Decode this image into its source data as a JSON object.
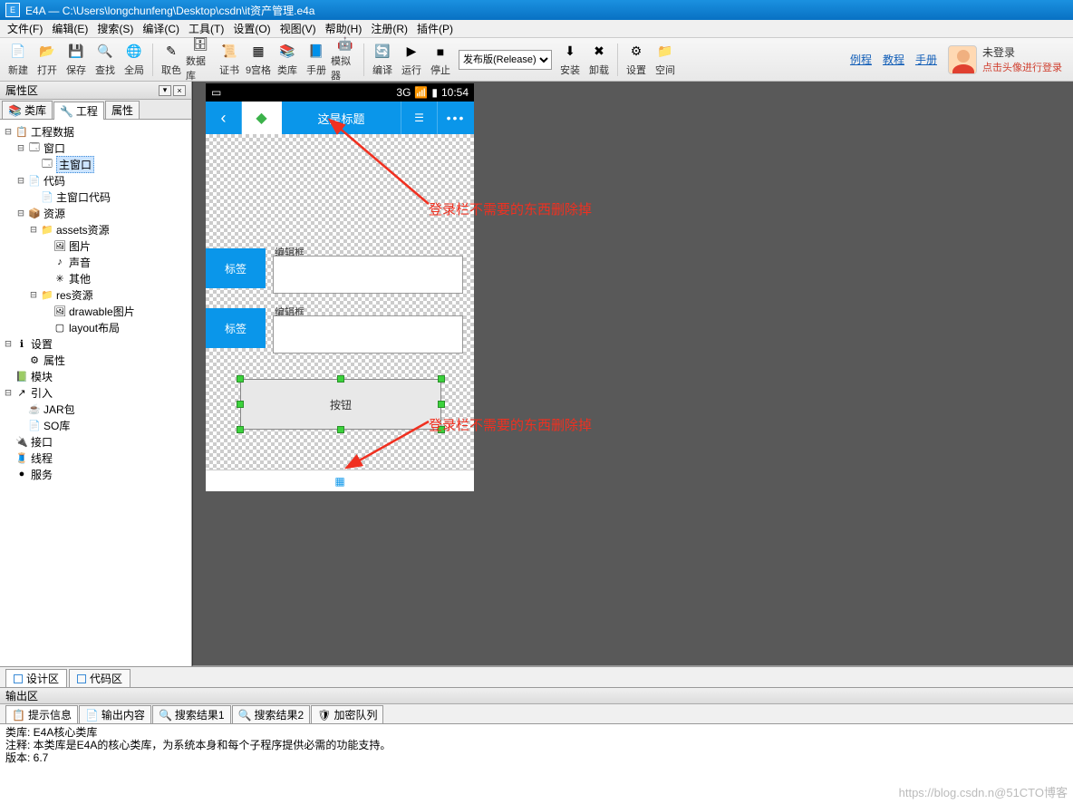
{
  "title": "E4A — C:\\Users\\longchunfeng\\Desktop\\csdn\\it资产管理.e4a",
  "menus": [
    "文件(F)",
    "编辑(E)",
    "搜索(S)",
    "编译(C)",
    "工具(T)",
    "设置(O)",
    "视图(V)",
    "帮助(H)",
    "注册(R)",
    "插件(P)"
  ],
  "toolbar": [
    {
      "lbl": "新建",
      "ico": "📄"
    },
    {
      "lbl": "打开",
      "ico": "📂"
    },
    {
      "lbl": "保存",
      "ico": "💾"
    },
    {
      "lbl": "查找",
      "ico": "🔍"
    },
    {
      "lbl": "全局",
      "ico": "🌐"
    },
    {
      "sep": true
    },
    {
      "lbl": "取色",
      "ico": "✎"
    },
    {
      "lbl": "数据库",
      "ico": "🗄"
    },
    {
      "lbl": "证书",
      "ico": "📜"
    },
    {
      "lbl": "9宫格",
      "ico": "▦"
    },
    {
      "lbl": "类库",
      "ico": "📚"
    },
    {
      "lbl": "手册",
      "ico": "📘"
    },
    {
      "lbl": "模拟器",
      "ico": "🤖"
    },
    {
      "sep": true
    },
    {
      "lbl": "编译",
      "ico": "🔄"
    },
    {
      "lbl": "运行",
      "ico": "▶"
    },
    {
      "lbl": "停止",
      "ico": "■"
    }
  ],
  "release_options": "发布版(Release)",
  "toolbar2": [
    {
      "lbl": "安装",
      "ico": "⬇"
    },
    {
      "lbl": "卸载",
      "ico": "✖"
    },
    {
      "sep": true
    },
    {
      "lbl": "设置",
      "ico": "⚙"
    },
    {
      "lbl": "空间",
      "ico": "📁"
    }
  ],
  "links": [
    "例程",
    "教程",
    "手册"
  ],
  "login": {
    "l1": "未登录",
    "l2": "点击头像进行登录"
  },
  "left": {
    "header": "属性区",
    "tabs": [
      {
        "lbl": "类库",
        "ico": "📚"
      },
      {
        "lbl": "工程",
        "ico": "🔧",
        "active": true
      },
      {
        "lbl": "属性",
        "ico": ""
      }
    ],
    "tree": [
      {
        "ind": 0,
        "tw": "-",
        "ico": "📋",
        "lbl": "工程数据"
      },
      {
        "ind": 1,
        "tw": "-",
        "ico": "🗔",
        "lbl": "窗口"
      },
      {
        "ind": 2,
        "tw": "",
        "ico": "🗔",
        "lbl": "主窗口",
        "sel": true
      },
      {
        "ind": 1,
        "tw": "-",
        "ico": "📄",
        "lbl": "代码"
      },
      {
        "ind": 2,
        "tw": "",
        "ico": "📄",
        "lbl": "主窗口代码"
      },
      {
        "ind": 1,
        "tw": "-",
        "ico": "📦",
        "lbl": "资源"
      },
      {
        "ind": 2,
        "tw": "-",
        "ico": "📁",
        "lbl": "assets资源"
      },
      {
        "ind": 3,
        "tw": "",
        "ico": "🖼",
        "lbl": "图片"
      },
      {
        "ind": 3,
        "tw": "",
        "ico": "♪",
        "lbl": "声音"
      },
      {
        "ind": 3,
        "tw": "",
        "ico": "✳",
        "lbl": "其他"
      },
      {
        "ind": 2,
        "tw": "-",
        "ico": "📁",
        "lbl": "res资源"
      },
      {
        "ind": 3,
        "tw": "",
        "ico": "🖼",
        "lbl": "drawable图片"
      },
      {
        "ind": 3,
        "tw": "",
        "ico": "▢",
        "lbl": "layout布局"
      },
      {
        "ind": 0,
        "tw": "-",
        "ico": "ℹ",
        "lbl": "设置"
      },
      {
        "ind": 1,
        "tw": "",
        "ico": "⚙",
        "lbl": "属性"
      },
      {
        "ind": 0,
        "tw": "",
        "ico": "📗",
        "lbl": "模块"
      },
      {
        "ind": 0,
        "tw": "-",
        "ico": "↗",
        "lbl": "引入"
      },
      {
        "ind": 1,
        "tw": "",
        "ico": "☕",
        "lbl": "JAR包"
      },
      {
        "ind": 1,
        "tw": "",
        "ico": "📄",
        "lbl": "SO库"
      },
      {
        "ind": 0,
        "tw": "",
        "ico": "🔌",
        "lbl": "接口"
      },
      {
        "ind": 0,
        "tw": "",
        "ico": "🧵",
        "lbl": "线程"
      },
      {
        "ind": 0,
        "tw": "",
        "ico": "●",
        "lbl": "服务"
      }
    ]
  },
  "device": {
    "net": "3G",
    "sig": "📶",
    "batt": "▮",
    "time": "10:54",
    "title": "这是标题",
    "labels": [
      "标签",
      "标签"
    ],
    "edits": [
      "编辑框",
      "编辑框"
    ],
    "button": "按钮"
  },
  "annot": {
    "t1": "登录栏不需要的东西删除掉",
    "t2": "登录栏不需要的东西删除掉"
  },
  "bottom_tabs": [
    {
      "lbl": "设计区",
      "active": true
    },
    {
      "lbl": "代码区"
    }
  ],
  "output": {
    "header": "输出区",
    "tabs": [
      {
        "lbl": "提示信息",
        "ico": "📋",
        "active": true
      },
      {
        "lbl": "输出内容",
        "ico": "📄"
      },
      {
        "lbl": "搜索结果1",
        "ico": "🔍"
      },
      {
        "lbl": "搜索结果2",
        "ico": "🔍"
      },
      {
        "lbl": "加密队列",
        "ico": "🛡"
      }
    ],
    "lines": [
      "类库: E4A核心类库",
      "注释: 本类库是E4A的核心类库，为系统本身和每个子程序提供必需的功能支持。",
      "版本: 6.7"
    ]
  },
  "watermark": "https://blog.csdn.n@51CTO博客"
}
